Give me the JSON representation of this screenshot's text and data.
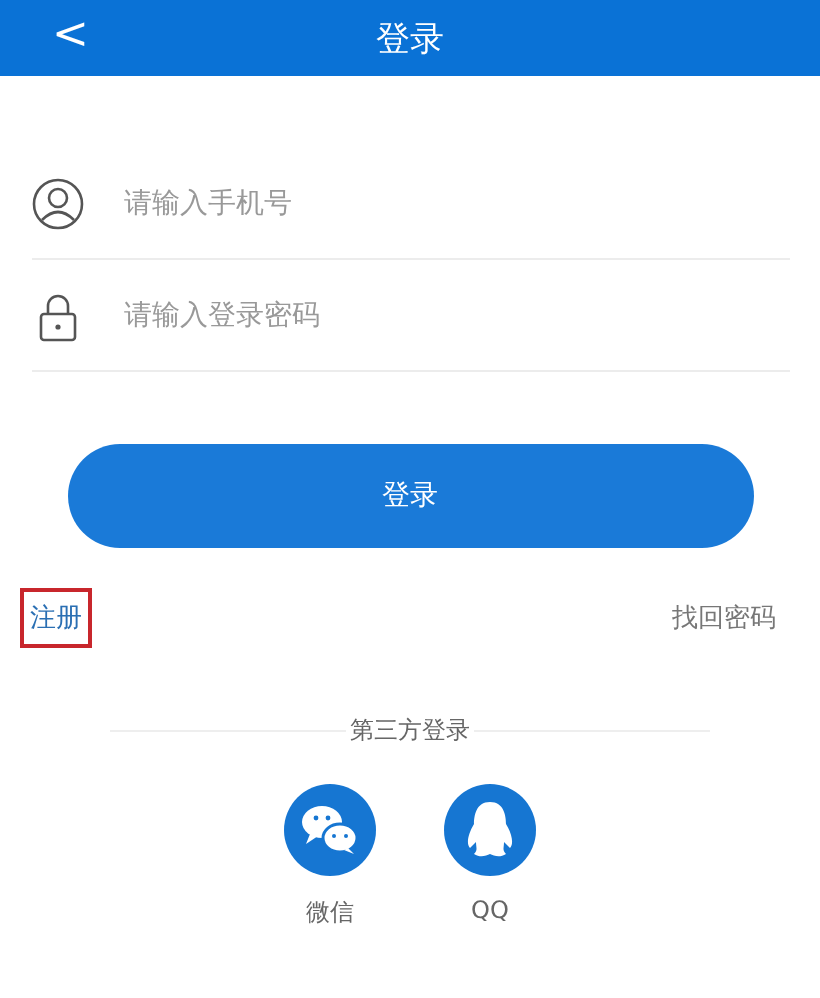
{
  "header": {
    "back": "<",
    "title": "登录"
  },
  "fields": [
    {
      "kind": "phone",
      "placeholder": "请输入手机号"
    },
    {
      "kind": "password",
      "placeholder": "请输入登录密码"
    }
  ],
  "login_button": "登录",
  "links": {
    "register": {
      "label": "注册",
      "highlighted": true
    },
    "forgot": "找回密码"
  },
  "third_party": {
    "title": "第三方登录",
    "items": [
      {
        "kind": "wechat",
        "label": "微信"
      },
      {
        "kind": "qq",
        "label": "QQ"
      }
    ]
  }
}
